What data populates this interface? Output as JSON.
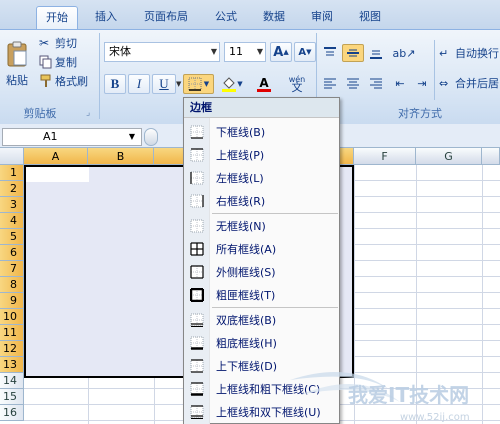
{
  "ribbon": {
    "tabs": [
      "开始",
      "插入",
      "页面布局",
      "公式",
      "数据",
      "审阅",
      "视图"
    ],
    "active_tab": "开始",
    "clipboard": {
      "paste": "粘贴",
      "cut": "剪切",
      "copy": "复制",
      "format_painter": "格式刷",
      "group_label": "剪贴板"
    },
    "font": {
      "name": "宋体",
      "size": "11",
      "bold": "B",
      "italic": "I",
      "underline": "U",
      "grow": "A",
      "shrink": "A",
      "font_color_letter": "A",
      "phonetic": "wén"
    },
    "alignment": {
      "wrap_text": "自动换行",
      "merge_center": "合并后居",
      "group_label": "对齐方式"
    }
  },
  "formula_bar": {
    "name_box": "A1"
  },
  "sheet": {
    "columns": [
      "A",
      "B",
      "F",
      "G"
    ],
    "rows": [
      "1",
      "2",
      "3",
      "4",
      "5",
      "6",
      "7",
      "8",
      "9",
      "10",
      "11",
      "12",
      "13",
      "14",
      "15",
      "16"
    ]
  },
  "border_menu": {
    "title": "边框",
    "items": [
      {
        "label": "下框线(B)",
        "icon": "bottom-border-icon"
      },
      {
        "label": "上框线(P)",
        "icon": "top-border-icon"
      },
      {
        "label": "左框线(L)",
        "icon": "left-border-icon"
      },
      {
        "label": "右框线(R)",
        "icon": "right-border-icon"
      },
      {
        "label": "无框线(N)",
        "icon": "no-border-icon"
      },
      {
        "label": "所有框线(A)",
        "icon": "all-borders-icon"
      },
      {
        "label": "外侧框线(S)",
        "icon": "outside-borders-icon"
      },
      {
        "label": "粗匣框线(T)",
        "icon": "thick-box-border-icon"
      },
      {
        "label": "双底框线(B)",
        "icon": "bottom-double-border-icon"
      },
      {
        "label": "粗底框线(H)",
        "icon": "thick-bottom-border-icon"
      },
      {
        "label": "上下框线(D)",
        "icon": "top-bottom-border-icon"
      },
      {
        "label": "上框线和粗下框线(C)",
        "icon": "top-thick-bottom-border-icon"
      },
      {
        "label": "上框线和双下框线(U)",
        "icon": "top-double-bottom-border-icon"
      }
    ]
  },
  "watermark": {
    "text": "我爱IT技术网",
    "url": "www.52ij.com"
  }
}
